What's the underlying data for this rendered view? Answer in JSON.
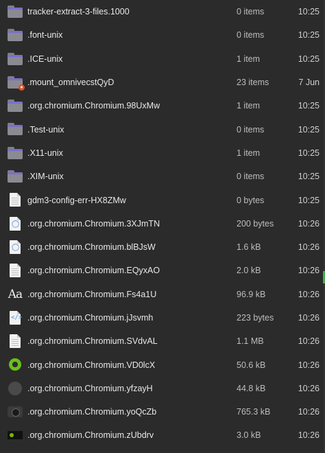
{
  "files": [
    {
      "icon": "folder-icon",
      "name": "tracker-extract-3-files.1000",
      "size": "0 items",
      "time": "10:25"
    },
    {
      "icon": "folder-icon",
      "name": ".font-unix",
      "size": "0 items",
      "time": "10:25"
    },
    {
      "icon": "folder-icon",
      "name": ".ICE-unix",
      "size": "1 item",
      "time": "10:25"
    },
    {
      "icon": "locked-folder-icon",
      "name": ".mount_omnivecstQyD",
      "size": "23 items",
      "time": "7 Jun"
    },
    {
      "icon": "folder-icon",
      "name": ".org.chromium.Chromium.98UxMw",
      "size": "1 item",
      "time": "10:25"
    },
    {
      "icon": "folder-icon",
      "name": ".Test-unix",
      "size": "0 items",
      "time": "10:25"
    },
    {
      "icon": "folder-icon",
      "name": ".X11-unix",
      "size": "1 item",
      "time": "10:25"
    },
    {
      "icon": "folder-icon",
      "name": ".XIM-unix",
      "size": "0 items",
      "time": "10:25"
    },
    {
      "icon": "document-icon",
      "name": "gdm3-config-err-HX8ZMw",
      "size": "0 bytes",
      "time": "10:25"
    },
    {
      "icon": "shield-document-icon",
      "name": ".org.chromium.Chromium.3XJmTN",
      "size": "200 bytes",
      "time": "10:26"
    },
    {
      "icon": "shield-document-icon",
      "name": ".org.chromium.Chromium.blBJsW",
      "size": "1.6 kB",
      "time": "10:26"
    },
    {
      "icon": "document-icon",
      "name": ".org.chromium.Chromium.EQyxAO",
      "size": "2.0 kB",
      "time": "10:26"
    },
    {
      "icon": "font-icon",
      "name": ".org.chromium.Chromium.Fs4a1U",
      "size": "96.9 kB",
      "time": "10:26"
    },
    {
      "icon": "code-document-icon",
      "name": ".org.chromium.Chromium.jJsvmh",
      "size": "223 bytes",
      "time": "10:26"
    },
    {
      "icon": "document-icon",
      "name": ".org.chromium.Chromium.SVdvAL",
      "size": "1.1 MB",
      "time": "10:26"
    },
    {
      "icon": "green-ring-icon",
      "name": ".org.chromium.Chromium.VD0lcX",
      "size": "50.6 kB",
      "time": "10:26"
    },
    {
      "icon": "dark-image-icon",
      "name": ".org.chromium.Chromium.yfzayH",
      "size": "44.8 kB",
      "time": "10:26"
    },
    {
      "icon": "camera-image-icon",
      "name": ".org.chromium.Chromium.yoQcZb",
      "size": "765.3 kB",
      "time": "10:26"
    },
    {
      "icon": "nvidia-image-icon",
      "name": ".org.chromium.Chromium.zUbdrv",
      "size": "3.0 kB",
      "time": "10:26"
    }
  ]
}
